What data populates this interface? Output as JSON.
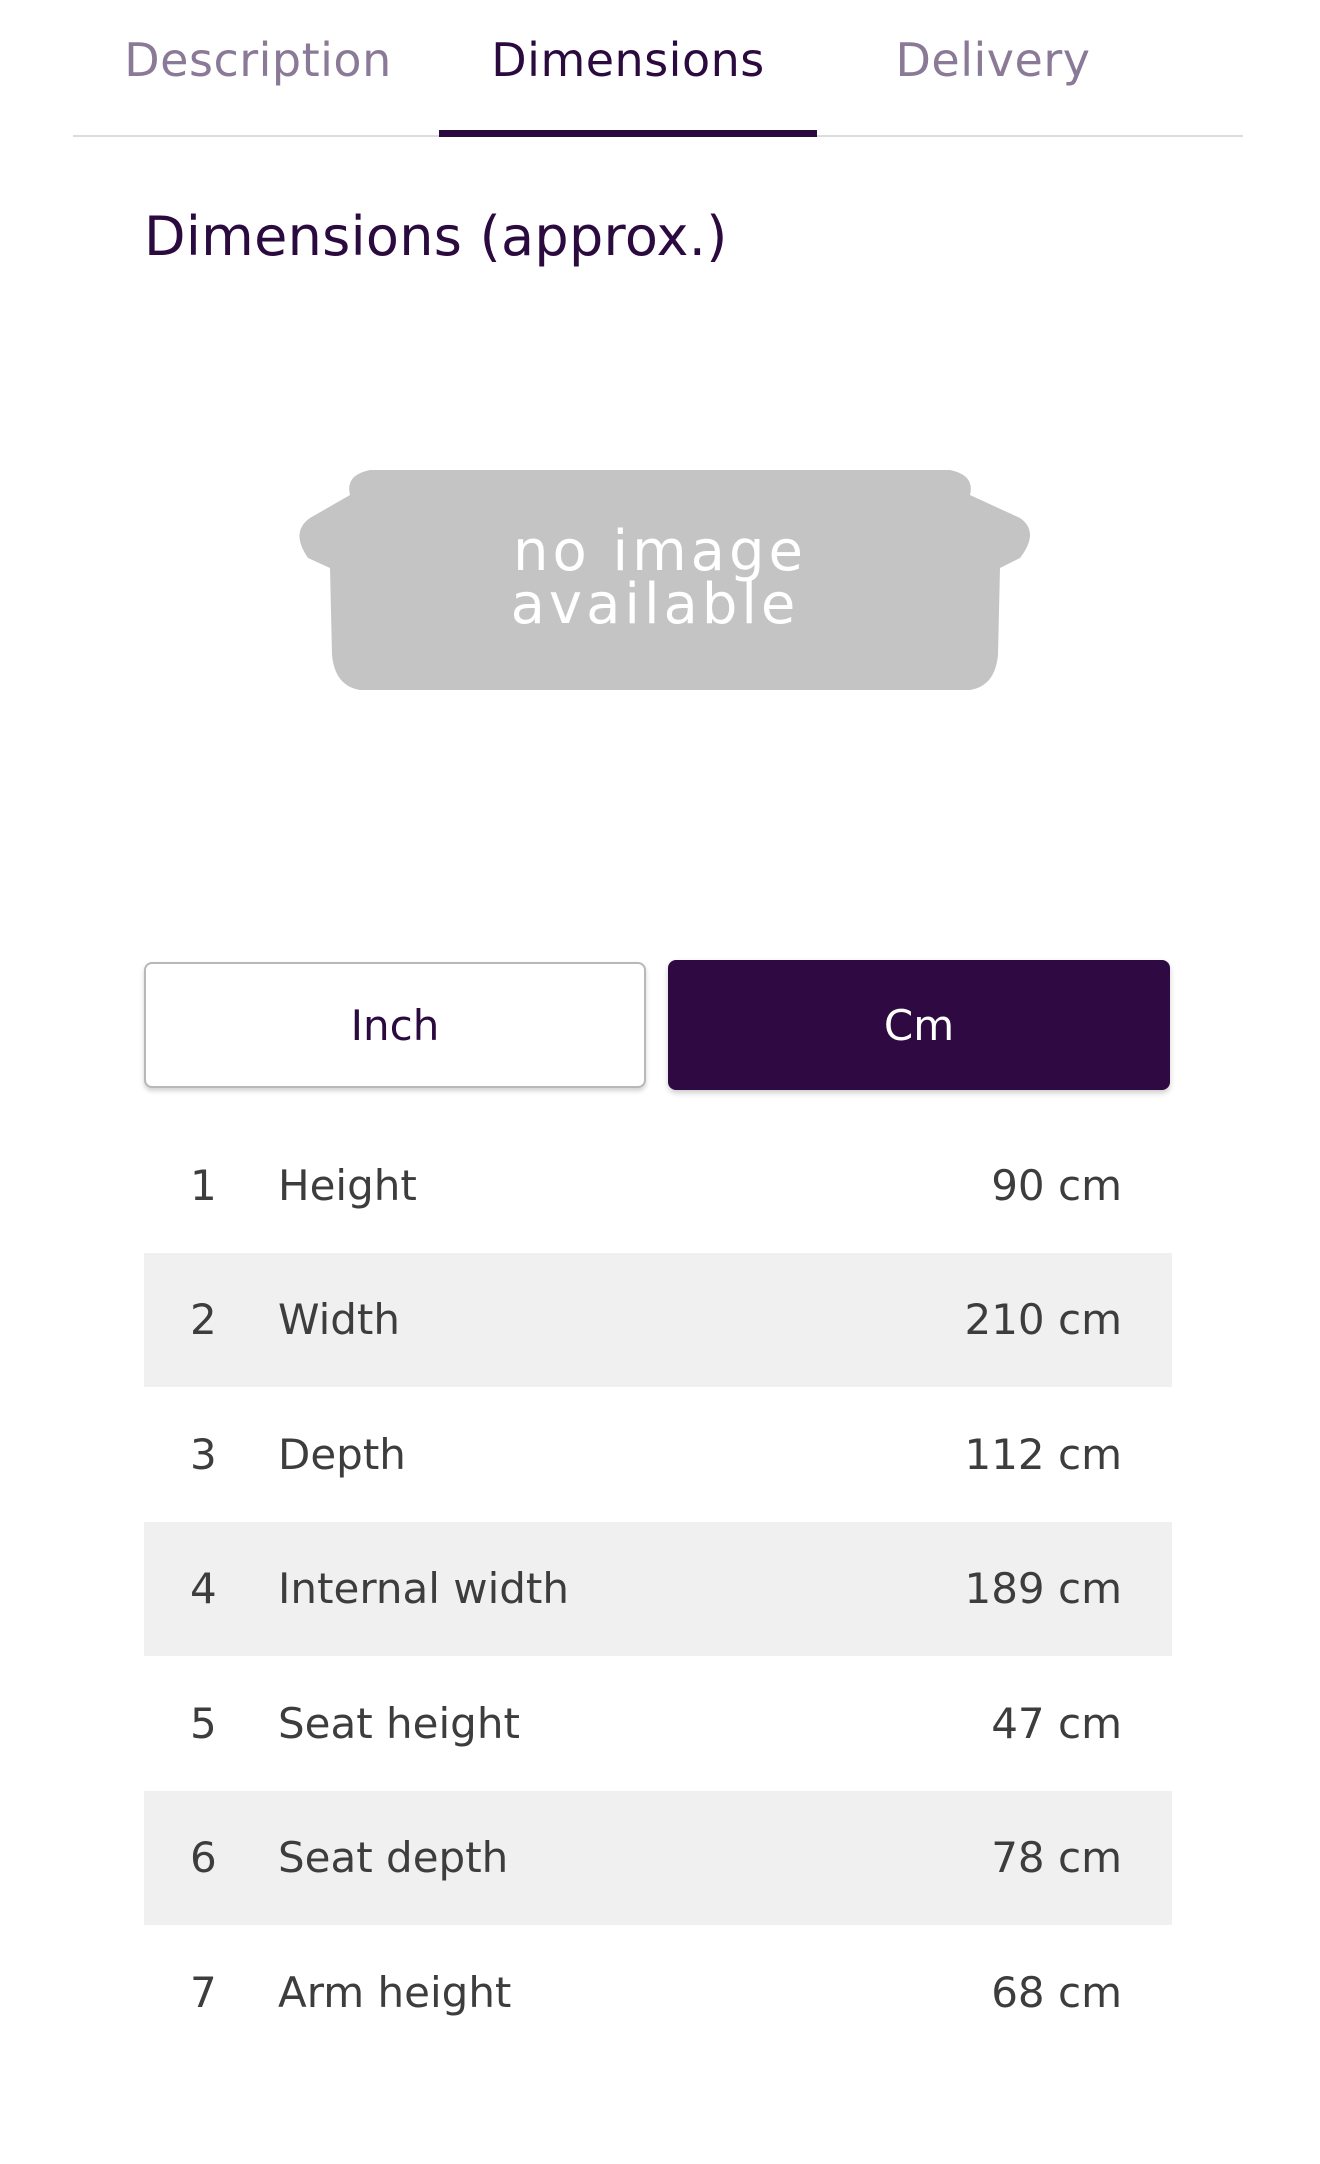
{
  "tabs": [
    {
      "label": "Description",
      "active": false
    },
    {
      "label": "Dimensions",
      "active": true
    },
    {
      "label": "Delivery",
      "active": false
    }
  ],
  "section_title": "Dimensions (approx.)",
  "image_placeholder": {
    "line1": "no image",
    "line2": "available"
  },
  "unit_toggle": {
    "inch_label": "Inch",
    "cm_label": "Cm",
    "selected": "Cm"
  },
  "dimensions": [
    {
      "num": "1",
      "label": "Height",
      "value": "90 cm"
    },
    {
      "num": "2",
      "label": "Width",
      "value": "210 cm"
    },
    {
      "num": "3",
      "label": "Depth",
      "value": "112 cm"
    },
    {
      "num": "4",
      "label": "Internal width",
      "value": "189 cm"
    },
    {
      "num": "5",
      "label": "Seat height",
      "value": "47 cm"
    },
    {
      "num": "6",
      "label": "Seat depth",
      "value": "78 cm"
    },
    {
      "num": "7",
      "label": "Arm height",
      "value": "68 cm"
    }
  ],
  "colors": {
    "brand": "#2e0942",
    "tab_inactive": "#8a7a98",
    "row_stripe": "#f0f0f1"
  }
}
